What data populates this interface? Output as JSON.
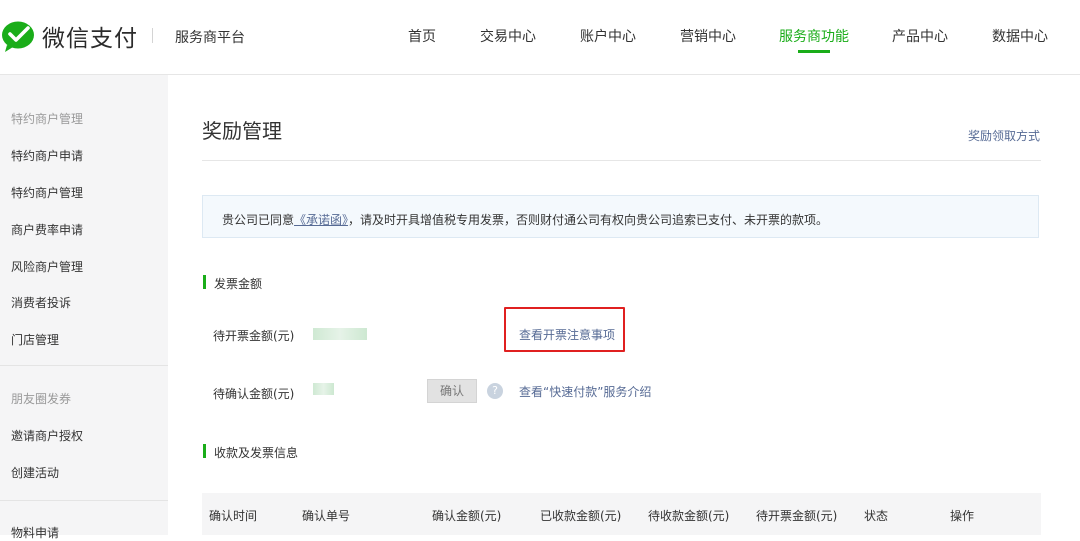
{
  "header": {
    "brand": "微信支付",
    "platform": "服务商平台",
    "nav": [
      "首页",
      "交易中心",
      "账户中心",
      "营销中心",
      "服务商功能",
      "产品中心",
      "数据中心"
    ],
    "active_nav": "服务商功能",
    "accent_color": "#1aad19"
  },
  "sidebar": {
    "group1": "特约商户管理",
    "group1_items": [
      "特约商户申请",
      "特约商户管理",
      "商户费率申请",
      "风险商户管理",
      "消费者投诉",
      "门店管理"
    ],
    "group2": "朋友圈发券",
    "group2_items": [
      "邀请商户授权",
      "创建活动"
    ],
    "group3": "物料申请"
  },
  "main": {
    "title": "奖励管理",
    "title_link": "奖励领取方式",
    "notice": {
      "prefix": "贵公司已同意",
      "link": "《承诺函》",
      "suffix": "，请及时开具增值税专用发票，否则财付通公司有权向贵公司追索已支付、未开票的款项。"
    },
    "section1": {
      "title": "发票金额",
      "row1_label": "待开票金额(元)",
      "row1_link": "查看开票注意事项",
      "row2_label": "待确认金额(元)",
      "confirm_button": "确认",
      "help_icon": "question-icon",
      "row2_link": "查看“快速付款”服务介绍"
    },
    "section2": {
      "title": "收款及发票信息",
      "columns": [
        "确认时间",
        "确认单号",
        "确认金额(元)",
        "已收款金额(元)",
        "待收款金额(元)",
        "待开票金额(元)",
        "状态",
        "操作"
      ]
    }
  }
}
